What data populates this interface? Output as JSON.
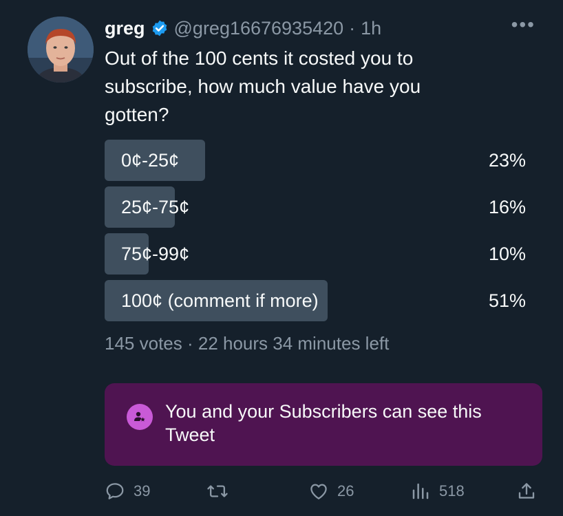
{
  "tweet": {
    "author_name": "greg",
    "handle": "@greg16676935420",
    "separator": "·",
    "time": "1h",
    "text": "Out of the 100 cents it costed you to subscribe, how much value have you gotten?"
  },
  "poll": {
    "options": [
      {
        "label": "0¢-25¢",
        "percent_text": "23%",
        "percent": 23
      },
      {
        "label": "25¢-75¢",
        "percent_text": "16%",
        "percent": 16
      },
      {
        "label": "75¢-99¢",
        "percent_text": "10%",
        "percent": 10
      },
      {
        "label": "100¢ (comment if more)",
        "percent_text": "51%",
        "percent": 51
      }
    ],
    "meta": "145 votes · 22 hours 34 minutes left"
  },
  "subscribers_banner": {
    "text": "You and your Subscribers can see this Tweet"
  },
  "actions": {
    "replies": "39",
    "retweets": "",
    "likes": "26",
    "views": "518"
  },
  "colors": {
    "background": "#15202b",
    "verified": "#1d9bf0",
    "poll_bar": "#3f4f5e",
    "banner": "#4f1451",
    "banner_icon": "#c95ad7",
    "muted_text": "#8b98a5"
  },
  "icons": {
    "verified": "verified-badge-icon",
    "more": "more-dots-icon",
    "subscriber": "subscriber-star-icon",
    "reply": "reply-bubble-icon",
    "retweet": "retweet-icon",
    "like": "heart-icon",
    "views": "views-chart-icon",
    "share": "share-upload-icon"
  }
}
